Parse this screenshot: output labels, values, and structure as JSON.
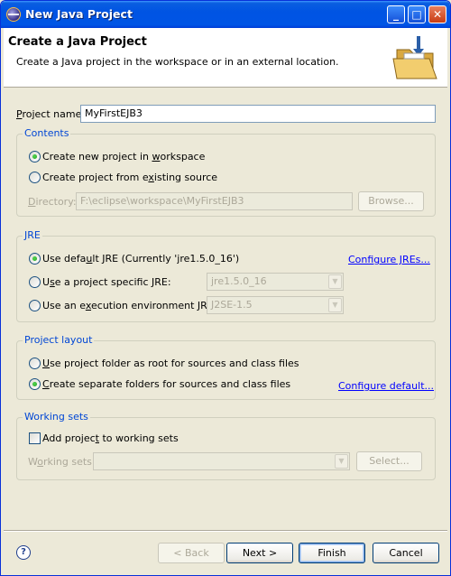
{
  "window": {
    "title": "New Java Project",
    "controls": {
      "minimize": "_",
      "maximize": "□",
      "close": "✕"
    }
  },
  "header": {
    "title": "Create a Java Project",
    "description": "Create a Java project in the workspace or in an external location."
  },
  "project_name": {
    "label_pre": "",
    "label_ul": "P",
    "label_post": "roject name:",
    "value": "MyFirstEJB3"
  },
  "contents": {
    "title": "Contents",
    "option_new": {
      "pre": "Create new project in ",
      "ul": "w",
      "post": "orkspace",
      "selected": true
    },
    "option_existing": {
      "pre": "Create project from e",
      "ul": "x",
      "post": "isting source",
      "selected": false
    },
    "directory": {
      "label_pre": "",
      "label_ul": "D",
      "label_post": "irectory:",
      "value": "F:\\eclipse\\workspace\\MyFirstEJB3",
      "browse": "Browse..."
    }
  },
  "jre": {
    "title": "JRE",
    "option_default": {
      "pre": "Use defa",
      "ul": "u",
      "post": "lt JRE (Currently 'jre1.5.0_16')",
      "selected": true
    },
    "configure_link": "Configure JREs...",
    "option_specific": {
      "pre": "U",
      "ul": "s",
      "post": "e a project specific JRE:",
      "selected": false,
      "combo": "jre1.5.0_16"
    },
    "option_env": {
      "pre": "Use an e",
      "ul": "x",
      "post": "ecution environment JRE:",
      "selected": false,
      "combo": "J2SE-1.5"
    }
  },
  "layout": {
    "title": "Project layout",
    "option_root": {
      "pre": "",
      "ul": "U",
      "post": "se project folder as root for sources and class files",
      "selected": false
    },
    "option_separate": {
      "pre": "",
      "ul": "C",
      "post": "reate separate folders for sources and class files",
      "selected": true
    },
    "configure_link": "Configure default..."
  },
  "working_sets": {
    "title": "Working sets",
    "add_check": {
      "pre": "Add projec",
      "ul": "t",
      "post": " to working sets",
      "checked": false
    },
    "label_pre": "W",
    "label_ul": "o",
    "label_post": "rking sets:",
    "combo": "",
    "select": "Select..."
  },
  "footer": {
    "help": "?",
    "back": "< Back",
    "next": "Next >",
    "finish": "Finish",
    "cancel": "Cancel"
  }
}
